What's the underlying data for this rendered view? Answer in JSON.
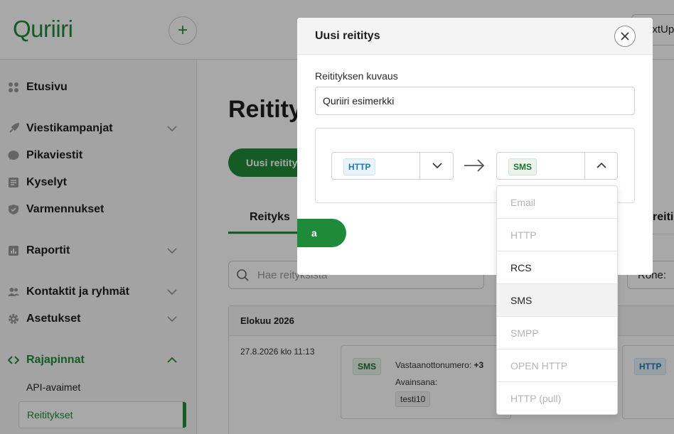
{
  "app": {
    "logo": "Quriiri",
    "top_right_button": "extUp"
  },
  "sidebar": {
    "items": [
      {
        "label": "Etusivu",
        "icon": "grid-icon"
      },
      {
        "label": "Viestikampanjat",
        "icon": "rocket-icon",
        "expandable": true
      },
      {
        "label": "Pikaviestit",
        "icon": "chat-bubble-icon"
      },
      {
        "label": "Kyselyt",
        "icon": "clipboard-icon"
      },
      {
        "label": "Varmennukset",
        "icon": "shield-check-icon"
      },
      {
        "label": "Raportit",
        "icon": "bar-chart-icon",
        "expandable": true
      },
      {
        "label": "Kontaktit ja ryhmät",
        "icon": "users-icon",
        "expandable": true
      },
      {
        "label": "Asetukset",
        "icon": "gear-icon",
        "expandable": true
      },
      {
        "label": "Rajapinnat",
        "icon": "code-icon",
        "expanded": true
      }
    ],
    "subitems": [
      {
        "label": "API-avaimet"
      },
      {
        "label": "Reititykset",
        "selected": true
      }
    ]
  },
  "main": {
    "title": "Reitity",
    "new_button": "Uusi reitity",
    "tabs": [
      "Reityks",
      "reiti"
    ],
    "search_placeholder": "Hae reityksista",
    "sort_label": "Rone:",
    "month_header": "Elokuu 2026",
    "row_date": "27.8.2026 klo 11:13",
    "card": {
      "badge": "SMS",
      "receiver_label": "Vastaanottonumero:",
      "receiver_value": "+3",
      "keyword_label": "Avainsana:",
      "keyword_value": "testi10"
    },
    "card2_badge": "HTTP"
  },
  "modal": {
    "title": "Uusi reititys",
    "description_label": "Reitityksen kuvaus",
    "description_value": "Quriiri esimerkki",
    "source": "HTTP",
    "target": "SMS",
    "save_button": "a"
  },
  "dropdown": {
    "options": [
      {
        "label": "Email",
        "state": "disabled"
      },
      {
        "label": "HTTP",
        "state": "disabled"
      },
      {
        "label": "RCS",
        "state": "enabled"
      },
      {
        "label": "SMS",
        "state": "selected"
      },
      {
        "label": "SMPP",
        "state": "disabled"
      },
      {
        "label": "OPEN HTTP",
        "state": "disabled"
      },
      {
        "label": "HTTP (pull)",
        "state": "disabled"
      }
    ]
  },
  "colors": {
    "brand_green": "#1f8a3a",
    "http_badge": "#1f78b4",
    "sms_badge": "#1f6e34"
  }
}
